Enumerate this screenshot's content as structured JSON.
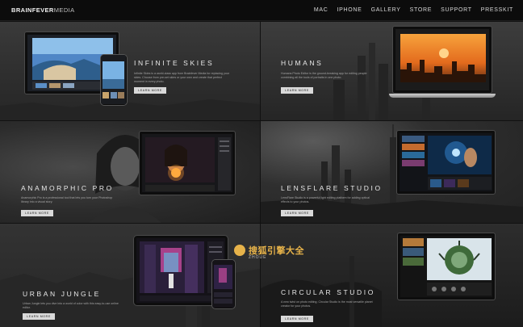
{
  "brand": {
    "bold": "BRAINFEVER",
    "light": "MEDIA"
  },
  "nav": {
    "items": [
      "MAC",
      "IPHONE",
      "GALLERY",
      "STORE",
      "SUPPORT",
      "PRESSKIT"
    ]
  },
  "tiles": [
    {
      "title": "INFINITE SKIES",
      "desc": "Infinite Skies is a world-class app from Brainfever Media for replacing your skies. Choose from pre-set skies or your own and create that perfect moment in every photo.",
      "button": "LEARN MORE"
    },
    {
      "title": "HUMANS",
      "desc": "Humans Photo Editor is the ground-breaking app for editing people combining all the tools of portraits in one photo.",
      "button": "LEARN MORE"
    },
    {
      "title": "ANAMORPHIC PRO",
      "desc": "Anamorphic Pro is a professional tool that lets you turn your Photoshop library into a visual story.",
      "button": "LEARN MORE"
    },
    {
      "title": "LENSFLARE STUDIO",
      "desc": "LensFlare Studio is a powerful light editing platform for adding optical effects to your photos.",
      "button": "LEARN MORE"
    },
    {
      "title": "URBAN JUNGLE",
      "desc": "Urban Jungle lets you dive into a world of color with this easy-to-use online editor.",
      "button": "LEARN MORE"
    },
    {
      "title": "CIRCULAR STUDIO",
      "desc": "A new twist on photo editing. Circular Studio is the most versatile planet creator for your photos.",
      "button": "LEARN MORE"
    }
  ],
  "watermark": {
    "text": "搜狐引擎大全",
    "sub": "ZHOUE"
  },
  "colors": {
    "nav_bg": "#0c0c0c",
    "button_bg": "#d9d9d9",
    "watermark": "#e7b34a"
  }
}
